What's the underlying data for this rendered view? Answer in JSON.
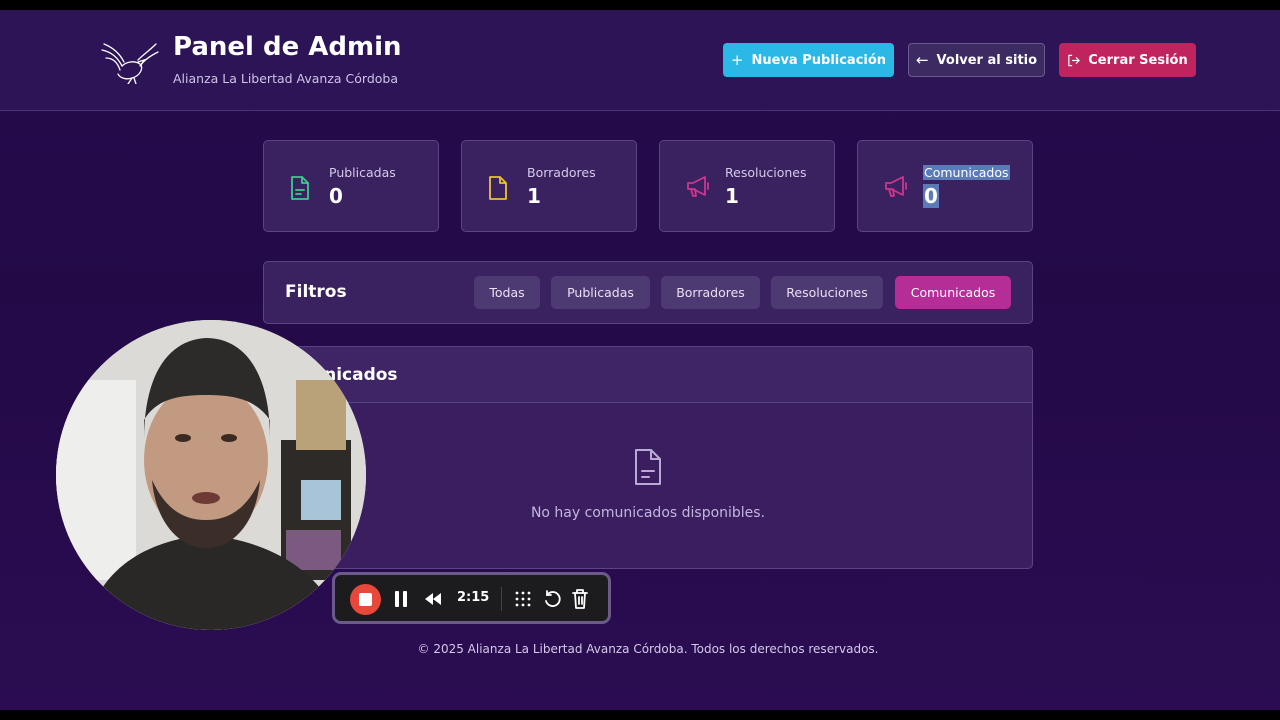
{
  "header": {
    "title": "Panel de Admin",
    "subtitle": "Alianza La Libertad Avanza Córdoba",
    "buttons": {
      "new_post": "Nueva Publicación",
      "back": "Volver al sitio",
      "logout": "Cerrar Sesión"
    }
  },
  "stats": [
    {
      "label": "Publicadas",
      "value": "0",
      "icon": "document-icon",
      "color": "#3ec98b"
    },
    {
      "label": "Borradores",
      "value": "1",
      "icon": "file-icon",
      "color": "#e9c23a"
    },
    {
      "label": "Resoluciones",
      "value": "1",
      "icon": "megaphone-icon",
      "color": "#d0358f"
    },
    {
      "label": "Comunicados",
      "value": "0",
      "icon": "megaphone-icon",
      "color": "#d0358f"
    }
  ],
  "filters": {
    "title": "Filtros",
    "options": [
      "Todas",
      "Publicadas",
      "Borradores",
      "Resoluciones",
      "Comunicados"
    ],
    "selected": "Comunicados"
  },
  "content": {
    "title": "unicados",
    "empty_message": "No hay comunicados disponibles."
  },
  "footer": "© 2025 Alianza La Libertad Avanza Córdoba. Todos los derechos reservados.",
  "recorder": {
    "time": "2:15"
  },
  "colors": {
    "accent_cyan": "#2bb8e6",
    "accent_magenta": "#b52d97",
    "logout_red": "#bf245f",
    "background": "#260b4c"
  }
}
